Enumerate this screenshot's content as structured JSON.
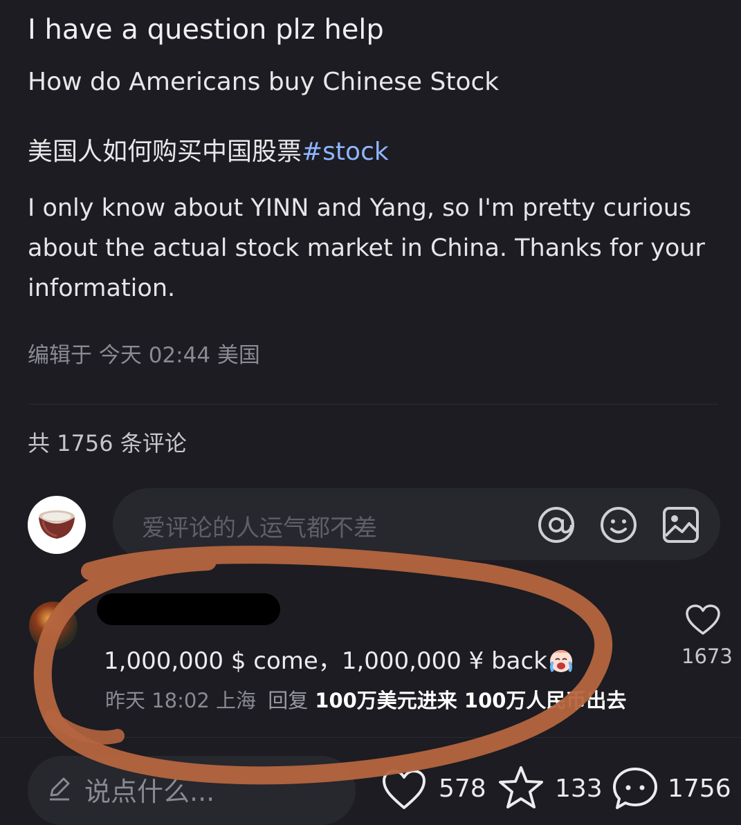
{
  "post": {
    "title": "I have a question plz help",
    "subtitle": "How do Americans buy Chinese Stock",
    "zh_text": "美国人如何购买中国股票",
    "hashtag": "#stock",
    "body": "I only know about YINN and Yang, so I'm pretty curious about the actual stock market in China. Thanks for your information.",
    "meta": "编辑于 今天 02:44 美国"
  },
  "comments_header": {
    "count_text": "共 1756 条评论"
  },
  "comment_input": {
    "placeholder": "爱评论的人运气都不差",
    "icons": [
      "at-icon",
      "smile-icon",
      "image-icon"
    ]
  },
  "comment": {
    "text": "1,000,000 $ come，1,000,000 ¥ back",
    "emoji": "crying-face",
    "time": "昨天 18:02",
    "location": "上海",
    "reply_label": "回复",
    "reply_content": "100万美元进来 100万人民币出去",
    "like_count": "1673"
  },
  "bottom_bar": {
    "say_placeholder": "说点什么...",
    "likes": "578",
    "stars": "133",
    "comments": "1756"
  },
  "colors": {
    "background": "#1c1c22",
    "hashtag": "#8fb6ff",
    "annotation_circle": "#b5653f"
  }
}
